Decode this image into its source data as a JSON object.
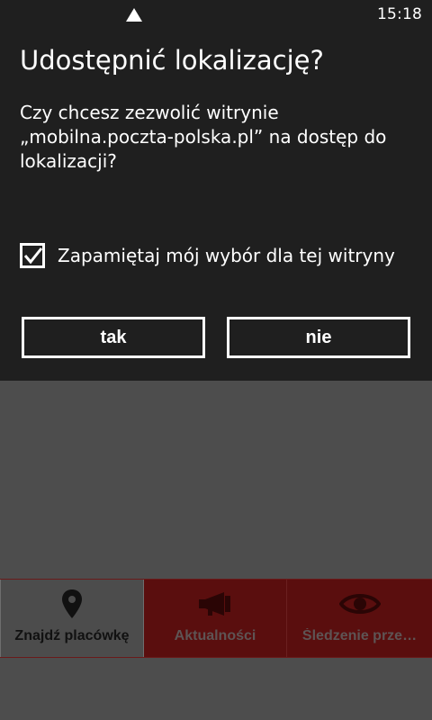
{
  "status_bar": {
    "time": "15:18",
    "signal_icon": "signal-triangle-icon"
  },
  "dialog": {
    "title": "Udostępnić lokalizację?",
    "message_lines": [
      "Czy chcesz zezwolić witrynie",
      "„mobilna.poczta-polska.pl” na dostęp do",
      "lokalizacji?"
    ],
    "remember_checked": true,
    "remember_label": "Zapamiętaj mój wybór dla tej witryny",
    "yes_label": "tak",
    "no_label": "nie"
  },
  "tabs": [
    {
      "label": "Znajdź placówkę",
      "icon": "map-pin-icon",
      "active": true
    },
    {
      "label": "Aktualności",
      "icon": "megaphone-icon",
      "active": false
    },
    {
      "label": "Śledzenie prze…",
      "icon": "eye-icon",
      "active": false
    }
  ],
  "colors": {
    "dialog_bg": "#1f1f1f",
    "overlay_bg": "#4d4d4d",
    "tab_inactive_bg": "#5a0e0e",
    "tab_active_bg": "#4c4c4c"
  }
}
